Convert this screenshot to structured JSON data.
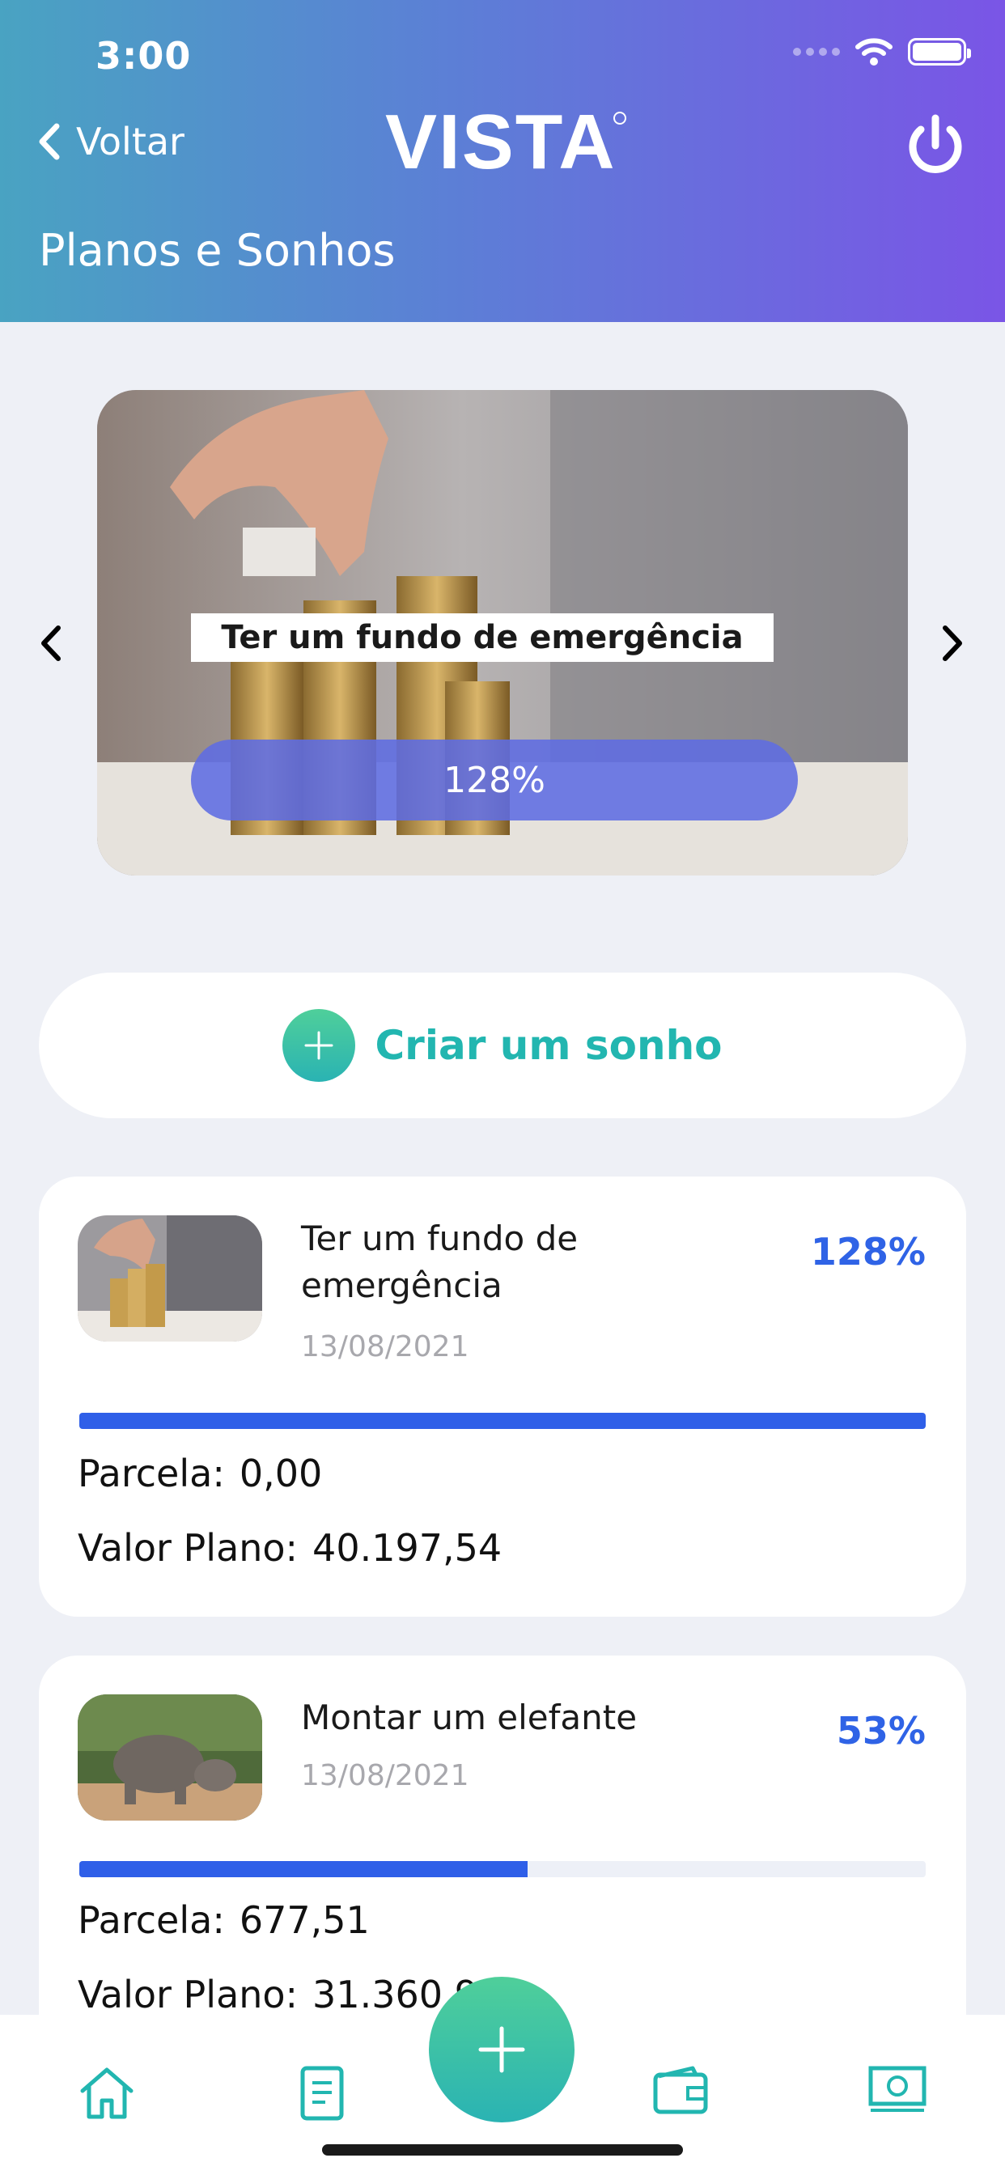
{
  "status_bar": {
    "time": "3:00"
  },
  "header": {
    "back_label": "Voltar",
    "logo_text": "VISTA",
    "page_title": "Planos e Sonhos"
  },
  "carousel": {
    "title": "Ter um fundo de emergência",
    "progress_label": "128%",
    "progress_value": 1.28
  },
  "create_button": {
    "label": "Criar um sonho"
  },
  "plans": [
    {
      "name": "Ter um fundo de emergência",
      "date": "13/08/2021",
      "percent_label": "128%",
      "progress": 1.0,
      "installment_label": "Parcela:",
      "installment_value": "0,00",
      "plan_value_label": "Valor Plano:",
      "plan_value": "40.197,54",
      "image": "coins-stack-photo"
    },
    {
      "name": "Montar um elefante",
      "date": "13/08/2021",
      "percent_label": "53%",
      "progress": 0.53,
      "installment_label": "Parcela:",
      "installment_value": "677,51",
      "plan_value_label": "Valor Plano:",
      "plan_value": "31.360,9",
      "image": "elephant-photo"
    }
  ],
  "tabbar": {
    "icons": [
      "home-icon",
      "document-icon",
      "plus-icon",
      "wallet-icon",
      "money-icon"
    ]
  },
  "colors": {
    "accent_teal": "#22b6b0",
    "progress_blue": "#2f5fe8",
    "header_gradient_start": "#49a3c2",
    "header_gradient_end": "#7a55e6"
  }
}
